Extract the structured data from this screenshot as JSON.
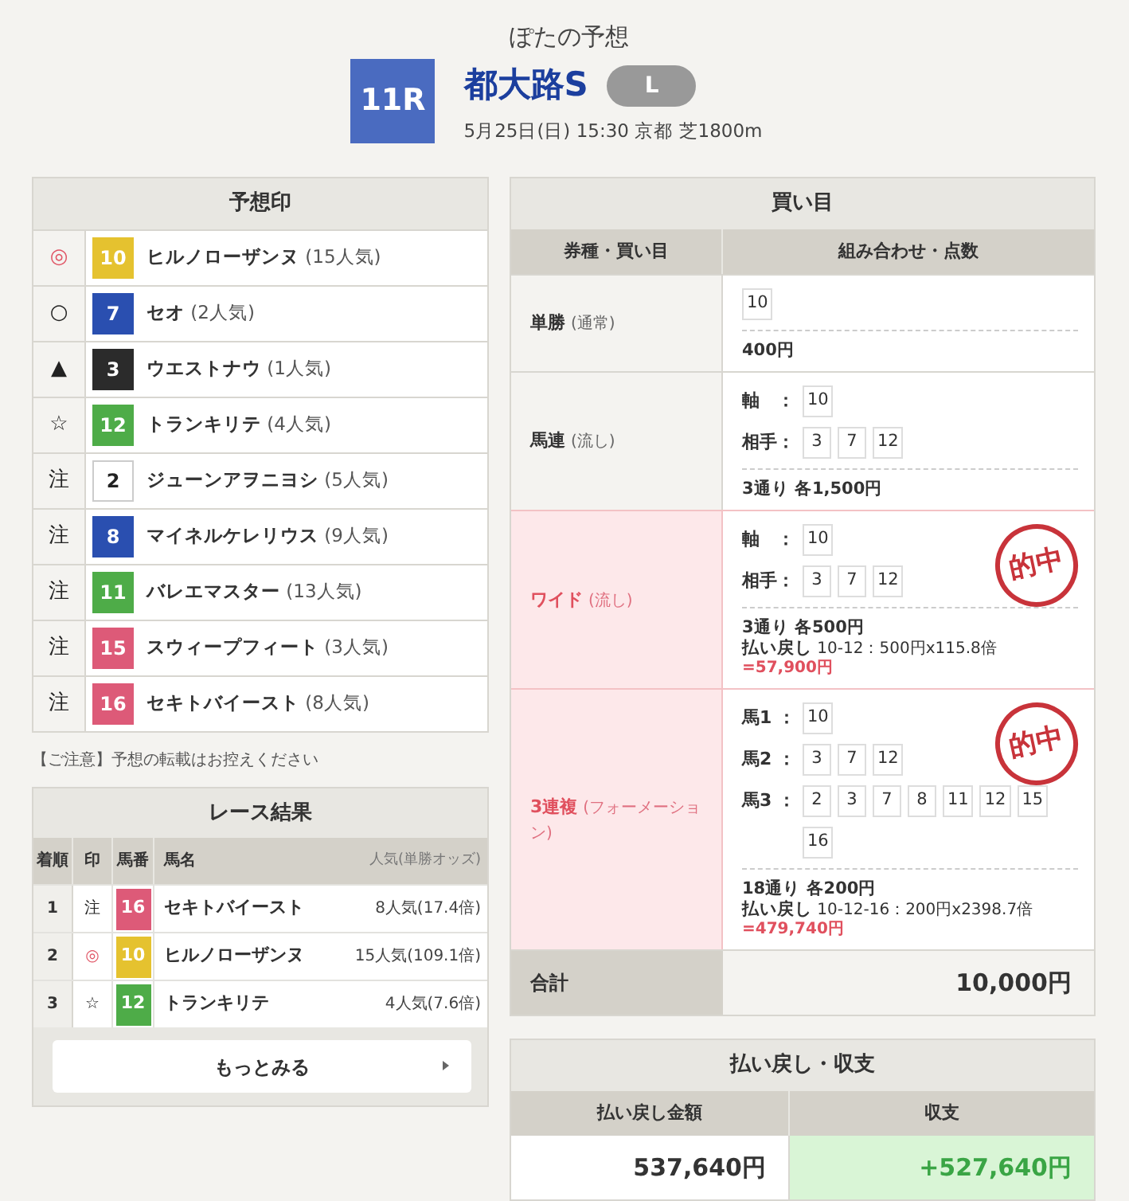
{
  "header": {
    "subtitle": "ぽたの予想",
    "race_number": "11R",
    "race_name": "都大路S",
    "grade": "L",
    "details": "5月25日(日) 15:30 京都 芝1800m"
  },
  "predictions": {
    "title": "予想印",
    "rows": [
      {
        "mark": "◎",
        "emphasized": true,
        "number": "10",
        "color": "#e5c22f",
        "horse": "ヒルノローザンヌ",
        "popularity": "(15人気)"
      },
      {
        "mark": "○",
        "emphasized": false,
        "number": "7",
        "color": "#2a4fb0",
        "horse": "セオ",
        "popularity": "(2人気)"
      },
      {
        "mark": "▲",
        "emphasized": false,
        "number": "3",
        "color": "#2b2b2b",
        "horse": "ウエストナウ",
        "popularity": "(1人気)"
      },
      {
        "mark": "☆",
        "emphasized": false,
        "number": "12",
        "color": "#4eac48",
        "horse": "トランキリテ",
        "popularity": "(4人気)"
      },
      {
        "mark": "注",
        "emphasized": false,
        "number": "2",
        "color": "#ffffff",
        "horse": "ジューンアヲニヨシ",
        "popularity": "(5人気)"
      },
      {
        "mark": "注",
        "emphasized": false,
        "number": "8",
        "color": "#2a4fb0",
        "horse": "マイネルケレリウス",
        "popularity": "(9人気)"
      },
      {
        "mark": "注",
        "emphasized": false,
        "number": "11",
        "color": "#4eac48",
        "horse": "バレエマスター",
        "popularity": "(13人気)"
      },
      {
        "mark": "注",
        "emphasized": false,
        "number": "15",
        "color": "#dd5a78",
        "horse": "スウィープフィート",
        "popularity": "(3人気)"
      },
      {
        "mark": "注",
        "emphasized": false,
        "number": "16",
        "color": "#dd5a78",
        "horse": "セキトバイースト",
        "popularity": "(8人気)"
      }
    ]
  },
  "notice": "【ご注意】予想の転載はお控えください",
  "results": {
    "title": "レース結果",
    "columns": [
      "着順",
      "印",
      "馬番",
      "馬名",
      "人気(単勝オッズ)"
    ],
    "rows": [
      {
        "place": "1",
        "mark": "注",
        "emphasized": false,
        "number": "16",
        "color": "#dd5a78",
        "horse": "セキトバイースト",
        "odds": "8人気(17.4倍)"
      },
      {
        "place": "2",
        "mark": "◎",
        "emphasized": true,
        "number": "10",
        "color": "#e5c22f",
        "horse": "ヒルノローザンヌ",
        "odds": "15人気(109.1倍)"
      },
      {
        "place": "3",
        "mark": "☆",
        "emphasized": false,
        "number": "12",
        "color": "#4eac48",
        "horse": "トランキリテ",
        "odds": "4人気(7.6倍)"
      }
    ],
    "more_button": "もっとみる"
  },
  "bets": {
    "title": "買い目",
    "columns": [
      "券種・買い目",
      "組み合わせ・点数"
    ],
    "rows": [
      {
        "type": "単勝",
        "method": "(通常)",
        "hit": false,
        "lines": [
          {
            "numbers": [
              "10"
            ]
          }
        ],
        "summary": "400円"
      },
      {
        "type": "馬連",
        "method": "(流し)",
        "hit": false,
        "lines": [
          {
            "label": "軸　：",
            "numbers": [
              "10"
            ]
          },
          {
            "label": "相手：",
            "numbers": [
              "3",
              "7",
              "12"
            ]
          }
        ],
        "summary": "3通り 各1,500円"
      },
      {
        "type": "ワイド",
        "method": "(流し)",
        "hit": true,
        "stamp": "的中",
        "lines": [
          {
            "label": "軸　：",
            "numbers": [
              "10"
            ]
          },
          {
            "label": "相手：",
            "numbers": [
              "3",
              "7",
              "12"
            ]
          }
        ],
        "summary": "3通り 各500円",
        "payout_label": "払い戻し",
        "payout_detail": "10-12：500円x115.8倍",
        "payout_amount": "=57,900円"
      },
      {
        "type": "3連複",
        "method": "(フォーメーション)",
        "hit": true,
        "stamp": "的中",
        "lines": [
          {
            "label": "馬1 ：",
            "numbers": [
              "10"
            ]
          },
          {
            "label": "馬2 ：",
            "numbers": [
              "3",
              "7",
              "12"
            ]
          },
          {
            "label": "馬3 ：",
            "numbers": [
              "2",
              "3",
              "7",
              "8",
              "11",
              "12",
              "15",
              "16"
            ]
          }
        ],
        "summary": "18通り 各200円",
        "payout_label": "払い戻し",
        "payout_detail": "10-12-16：200円x2398.7倍",
        "payout_amount": "=479,740円"
      }
    ],
    "total_label": "合計",
    "total": "10,000円"
  },
  "payout": {
    "title": "払い戻し・収支",
    "columns": [
      "払い戻し金額",
      "収支"
    ],
    "amount": "537,640円",
    "balance": "+527,640円",
    "profit": true
  }
}
